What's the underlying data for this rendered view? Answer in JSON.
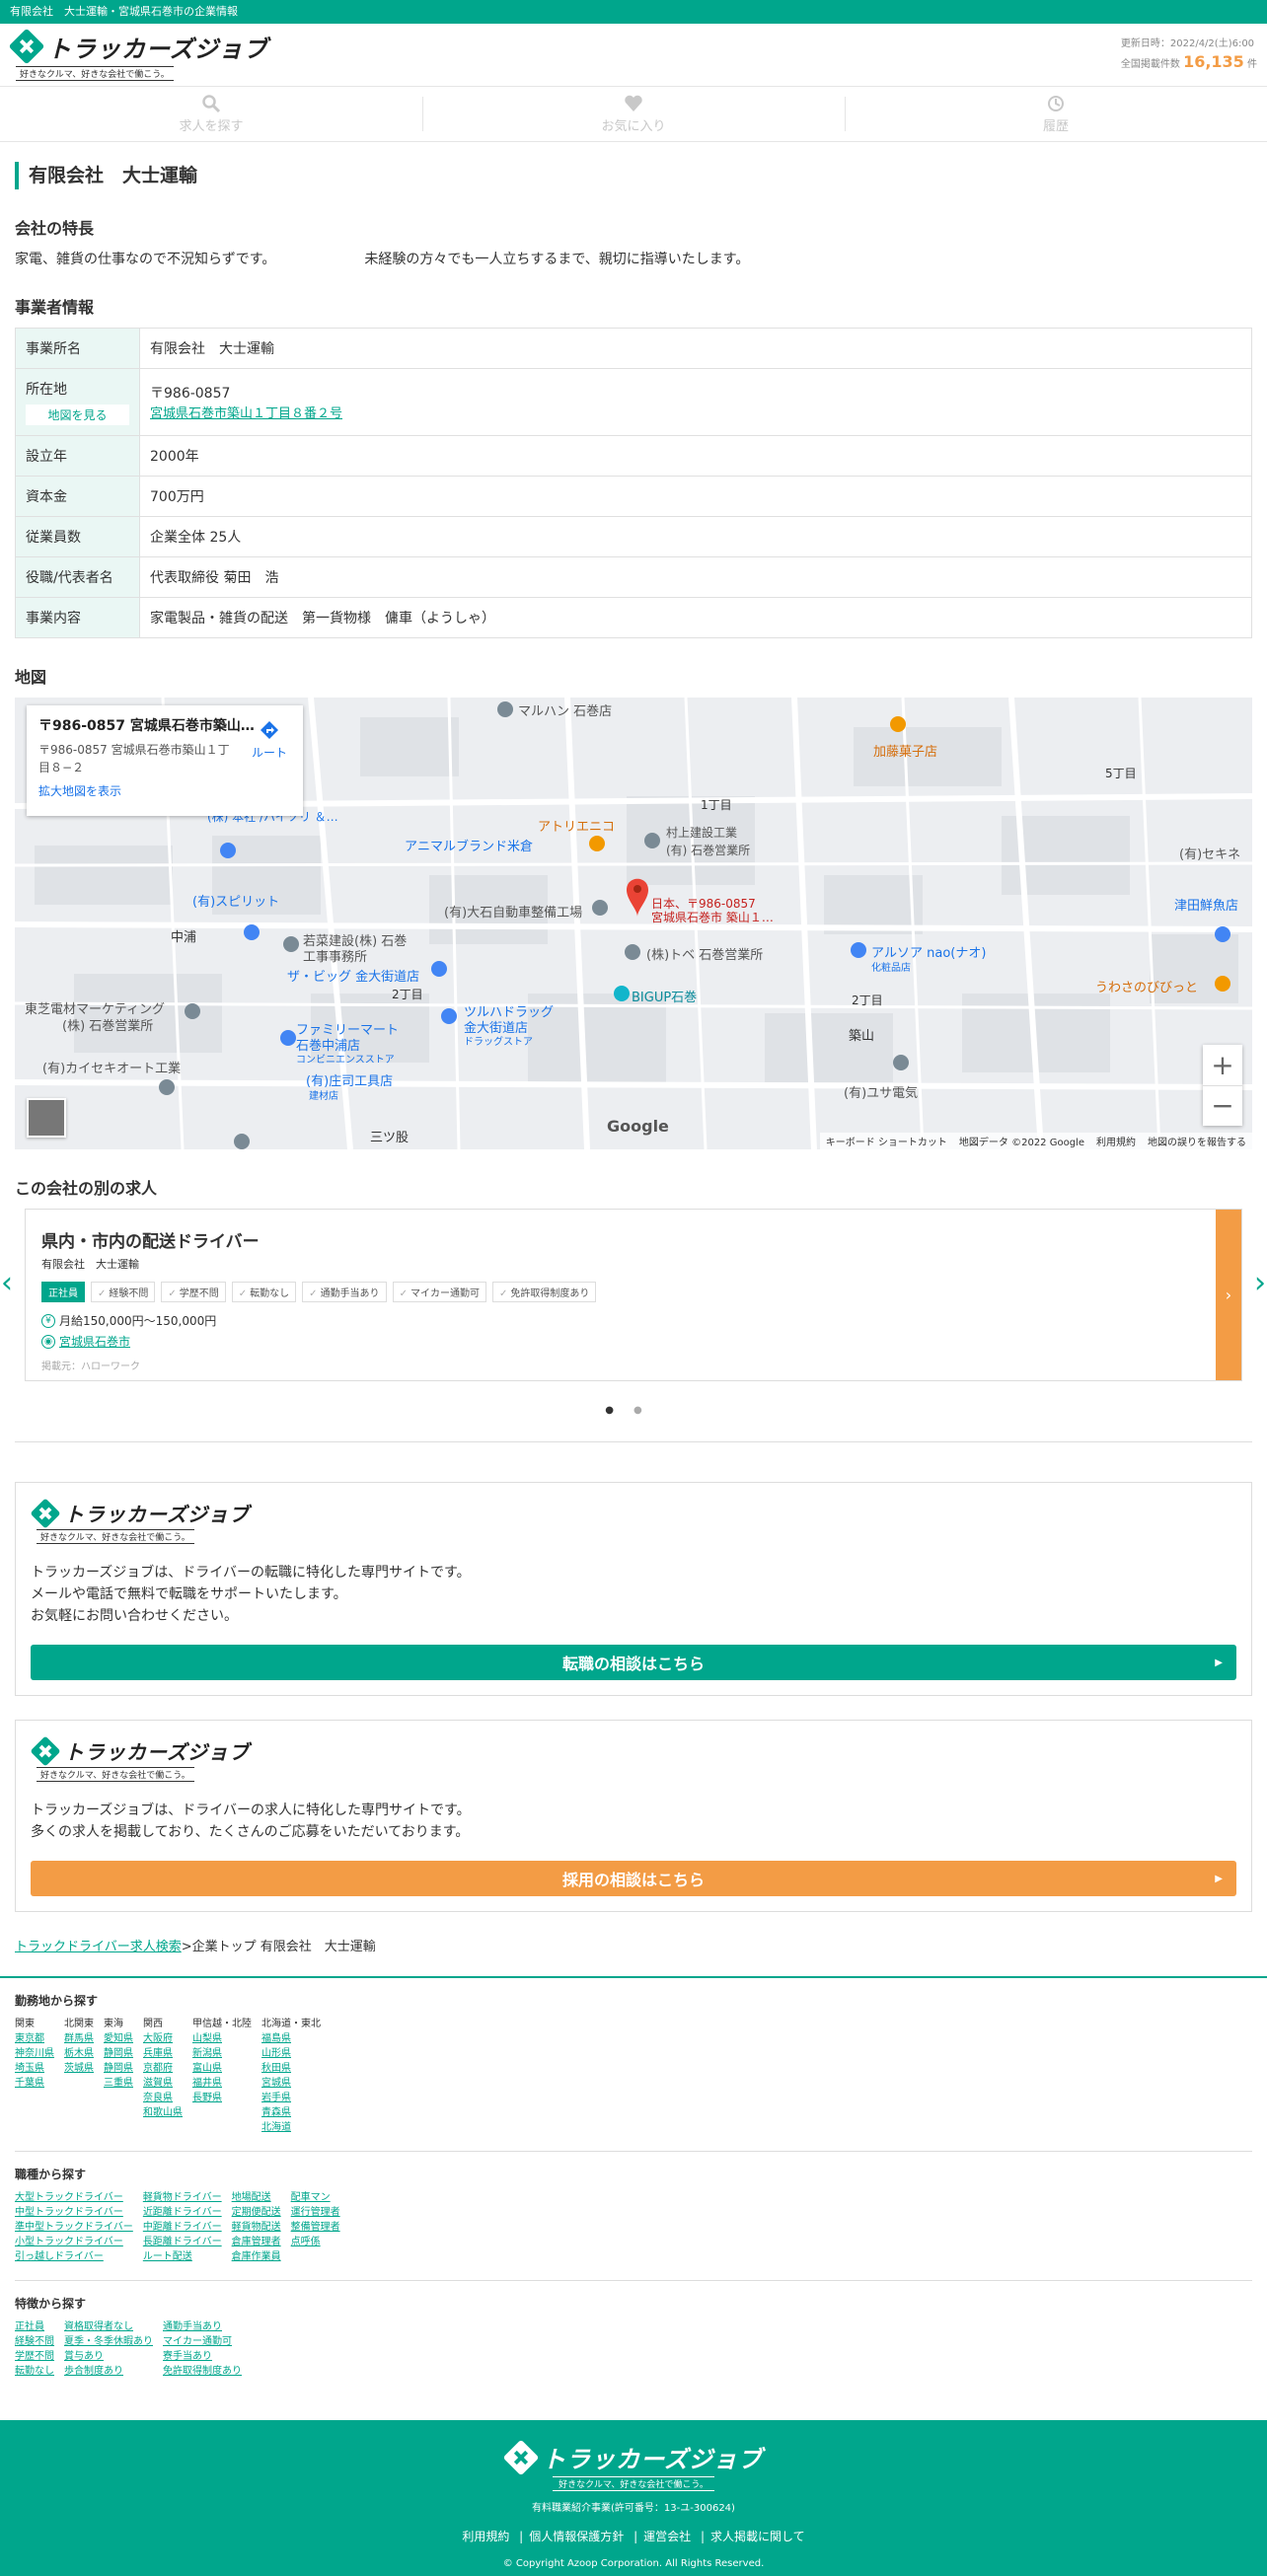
{
  "topbar": {
    "text": "有限会社　大士運輸・宮城県石巻市の企業情報"
  },
  "header": {
    "logo_text": "トラッカーズジョブ",
    "logo_tagline": "好きなクルマ、好きな会社で働こう。",
    "updated": "更新日時：2022/4/2(土)6:00",
    "total_label": "全国掲載件数",
    "total_count": "16,135",
    "total_unit": "件"
  },
  "nav": {
    "search": "求人を探す",
    "favorites": "お気に入り",
    "history": "履歴"
  },
  "company": {
    "name": "有限会社　大士運輸",
    "features_heading": "会社の特長",
    "features": [
      "家電、雑貨の仕事なので不況知らずです。",
      "未経験の方々でも一人立ちするまで、親切に指導いたします。"
    ],
    "info_heading": "事業者情報",
    "rows": [
      {
        "label": "事業所名",
        "value": "有限会社　大士運輸"
      },
      {
        "label": "設立年",
        "value": "2000年"
      },
      {
        "label": "資本金",
        "value": "700万円"
      },
      {
        "label": "従業員数",
        "value": "企業全体 25人"
      },
      {
        "label": "役職/代表者名",
        "value": "代表取締役 菊田　浩"
      },
      {
        "label": "事業内容",
        "value": "家電製品・雑貨の配送　第一貨物様　傭車（ようしゃ）"
      }
    ],
    "address_label": "所在地",
    "address_btn": "地図を見る",
    "zip": "〒986-0857",
    "address": "宮城県石巻市築山１丁目８番２号"
  },
  "map": {
    "heading": "地図",
    "card_title": "〒986-0857 宮城県石巻市築山…",
    "card_address": "〒986-0857 宮城県石巻市築山１丁目８−２",
    "card_enlarge": "拡大地図を表示",
    "route": "ルート",
    "pin_label_1": "日本、〒986-0857",
    "pin_label_2": "宮城県石巻市 築山１…",
    "labels": {
      "maruhan": "マルハン 石巻店",
      "kato": "加藤菓子店",
      "atorie": "アトリエニコ",
      "animal": "アニマルブランド米倉",
      "murakami": "村上建設工業",
      "murakami2": "(有) 石巻営業所",
      "chome1": "1丁目",
      "chome5": "5丁目",
      "sekine": "(有)セキネ",
      "spirit": "(有)スピリット",
      "nakaura": "中浦",
      "oishi": "(有)大石自動車整備工場",
      "tsudaya": "津田鮮魚店",
      "wakana": "若菜建設(株) 石巻",
      "wakana2": "工事事務所",
      "big": "ザ・ビッグ 金大街道店",
      "chome2": "2丁目",
      "tobe": "(株)トベ 石巻営業所",
      "alsoa": "アルソア nao(ナオ)",
      "alsoa2": "化粧品店",
      "chome2b": "2丁目",
      "uwasa": "うわさのびびっと",
      "toshiba": "東芝電材マーケティング",
      "toshiba2": "(株) 石巻営業所",
      "family": "ファミリーマート",
      "family2": "石巻中浦店",
      "family3": "コンビニエンスストア",
      "tsuruha": "ツルハドラッグ",
      "tsuruha2": "金大街道店",
      "tsuruha3": "ドラッグストア",
      "bigup": "BIGUP石巻",
      "tsukiyama": "築山",
      "kaisei": "(有)カイセキオート工業",
      "shoji": "(有)庄司工具店",
      "shoji2": "建材店",
      "yusa": "(有)ユサ電気",
      "mitsumata": "三ツ股",
      "honten": "(株) 本社 /ハイソリ ＆…"
    },
    "footer": [
      "キーボード ショートカット",
      "地図データ ©2022 Google",
      "利用規約",
      "地図の誤りを報告する"
    ],
    "google": "Google"
  },
  "other_jobs": {
    "heading": "この会社の別の求人",
    "title": "県内・市内の配送ドライバー",
    "company": "有限会社　大士運輸",
    "tags": [
      "正社員",
      "経験不問",
      "学歴不問",
      "転勤なし",
      "通勤手当あり",
      "マイカー通勤可",
      "免許取得制度あり"
    ],
    "salary": "月給150,000円〜150,000円",
    "location": "宮城県石巻市",
    "source": "掲載元：ハローワーク"
  },
  "promo1": {
    "text": [
      "トラッカーズジョブは、ドライバーの転職に特化した専門サイトです。",
      "メールや電話で無料で転職をサポートいたします。",
      "お気軽にお問い合わせください。"
    ],
    "button": "転職の相談はこちら"
  },
  "promo2": {
    "text": [
      "トラッカーズジョブは、ドライバーの求人に特化した専門サイトです。",
      "多くの求人を掲載しており、たくさんのご応募をいただいております。"
    ],
    "button": "採用の相談はこちら"
  },
  "breadcrumb": {
    "link": "トラックドライバー求人検索",
    "rest": ">企業トップ 有限会社　大士運輸"
  },
  "area_search": {
    "heading": "勤務地から探す",
    "cols": [
      {
        "head": "関東",
        "items": [
          "東京都",
          "神奈川県",
          "埼玉県",
          "千葉県"
        ]
      },
      {
        "head": "北関東",
        "items": [
          "群馬県",
          "栃木県",
          "茨城県"
        ]
      },
      {
        "head": "東海",
        "items": [
          "愛知県",
          "静岡県",
          "静岡県",
          "三重県"
        ]
      },
      {
        "head": "関西",
        "items": [
          "大阪府",
          "兵庫県",
          "京都府",
          "滋賀県",
          "奈良県",
          "和歌山県"
        ]
      },
      {
        "head": "甲信越・北陸",
        "items": [
          "山梨県",
          "新潟県",
          "富山県",
          "福井県",
          "長野県"
        ]
      },
      {
        "head": "北海道・東北",
        "items": [
          "福島県",
          "山形県",
          "秋田県",
          "宮城県",
          "岩手県",
          "青森県",
          "北海道"
        ]
      }
    ]
  },
  "job_search": {
    "heading": "職種から探す",
    "cols": [
      {
        "items": [
          "大型トラックドライバー",
          "中型トラックドライバー",
          "準中型トラックドライバー",
          "小型トラックドライバー",
          "引っ越しドライバー"
        ]
      },
      {
        "items": [
          "軽貨物ドライバー",
          "近距離ドライバー",
          "中距離ドライバー",
          "長距離ドライバー",
          "ルート配送"
        ]
      },
      {
        "items": [
          "地場配送",
          "定期便配送",
          "軽貨物配送",
          "倉庫管理者",
          "倉庫作業員"
        ]
      },
      {
        "items": [
          "配車マン",
          "運行管理者",
          "整備管理者",
          "点呼係"
        ]
      }
    ]
  },
  "feature_search": {
    "heading": "特徴から探す",
    "cols": [
      {
        "items": [
          "正社員",
          "経験不問",
          "学歴不問",
          "転勤なし"
        ]
      },
      {
        "items": [
          "資格取得者なし",
          "夏季・冬季休暇あり",
          "賞与あり",
          "歩合制度あり"
        ]
      },
      {
        "items": [
          "通勤手当あり",
          "マイカー通勤可",
          "寮手当あり",
          "免許取得制度あり"
        ]
      }
    ]
  },
  "footer": {
    "license": "有料職業紹介事業(許可番号：13-ユ-300624)",
    "links": [
      "利用規約",
      "個人情報保護方針",
      "運営会社",
      "求人掲載に関して"
    ],
    "copyright": "© Copyright Azoop Corporation. All Rights Reserved."
  },
  "colors": {
    "brand": "#00a68c",
    "accent": "#f39c45"
  }
}
